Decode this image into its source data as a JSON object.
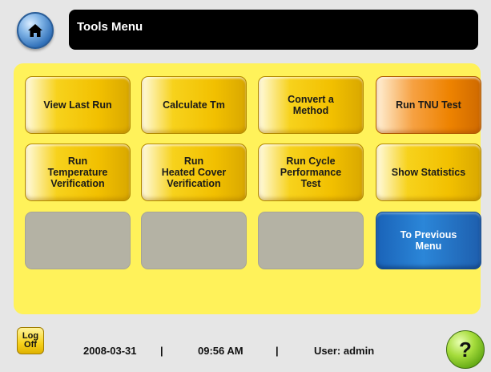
{
  "header": {
    "home_icon": "home-icon",
    "title": "Tools Menu"
  },
  "menu": {
    "view_last_run": "View Last Run",
    "calculate_tm": "Calculate Tm",
    "convert_method": "Convert a\nMethod",
    "run_tnu_test": "Run TNU Test",
    "run_temperature_verification": "Run\nTemperature\nVerification",
    "run_heated_cover_verification": "Run\nHeated Cover\nVerification",
    "run_cycle_performance_test": "Run Cycle\nPerformance\nTest",
    "show_statistics": "Show Statistics",
    "to_previous_menu": "To Previous\nMenu"
  },
  "footer": {
    "logoff_label": "Log\nOff",
    "date": "2008-03-31",
    "separator": "|",
    "time": "09:56 AM",
    "user": "User: admin",
    "help_label": "?"
  },
  "colors": {
    "panel": "#fff25a",
    "yellow_button": "#f2c000",
    "orange_button": "#ee8300",
    "blue_button": "#2b86d8",
    "disabled_button": "#b4b2a4"
  }
}
